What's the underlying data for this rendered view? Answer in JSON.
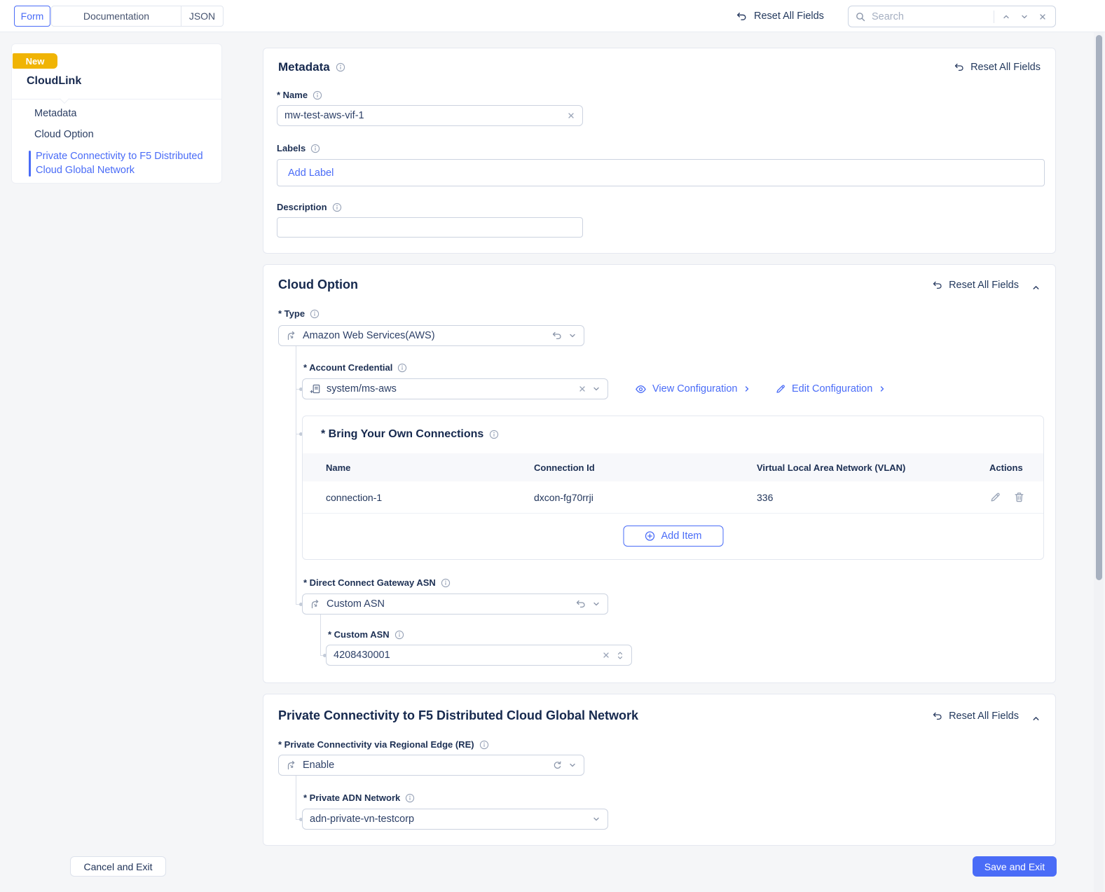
{
  "colors": {
    "accent": "#4a6cf7",
    "badge": "#f0b404",
    "heading": "#16294e"
  },
  "topbar": {
    "tabs": {
      "form": "Form",
      "documentation": "Documentation",
      "json": "JSON"
    },
    "reset_all_fields": "Reset All Fields",
    "search_placeholder": "Search"
  },
  "sidebar": {
    "badge": "New",
    "title": "CloudLink",
    "items": [
      {
        "label": "Metadata"
      },
      {
        "label": "Cloud Option"
      },
      {
        "label": "Private Connectivity to F5 Distributed Cloud Global Network"
      }
    ]
  },
  "metadata_section": {
    "title": "Metadata",
    "reset": "Reset All Fields",
    "name_label": "* Name",
    "name_value": "mw-test-aws-vif-1",
    "labels_label": "Labels",
    "add_label": "Add Label",
    "description_label": "Description",
    "description_value": ""
  },
  "cloud_option_section": {
    "title": "Cloud Option",
    "reset": "Reset All Fields",
    "type_label": "* Type",
    "type_value": "Amazon Web Services(AWS)",
    "account_credential_label": "* Account Credential",
    "account_credential_value": "system/ms-aws",
    "view_configuration": "View Configuration",
    "edit_configuration": "Edit Configuration",
    "byoc_title": "* Bring Your Own Connections",
    "byoc_columns": [
      "Name",
      "Connection Id",
      "Virtual Local Area Network (VLAN)",
      "Actions"
    ],
    "byoc_rows": [
      {
        "name": "connection-1",
        "connection_id": "dxcon-fg70rrji",
        "vlan": "336"
      }
    ],
    "add_item": "Add Item",
    "dcg_asn_label": "* Direct Connect Gateway ASN",
    "dcg_asn_value": "Custom ASN",
    "custom_asn_label": "* Custom ASN",
    "custom_asn_value": "4208430001"
  },
  "private_connectivity_section": {
    "title": "Private Connectivity to F5 Distributed Cloud Global Network",
    "reset": "Reset All Fields",
    "re_label": "* Private Connectivity via Regional Edge (RE)",
    "re_value": "Enable",
    "adn_label": "* Private ADN Network",
    "adn_value": "adn-private-vn-testcorp"
  },
  "footer": {
    "cancel": "Cancel and Exit",
    "save": "Save and Exit"
  }
}
